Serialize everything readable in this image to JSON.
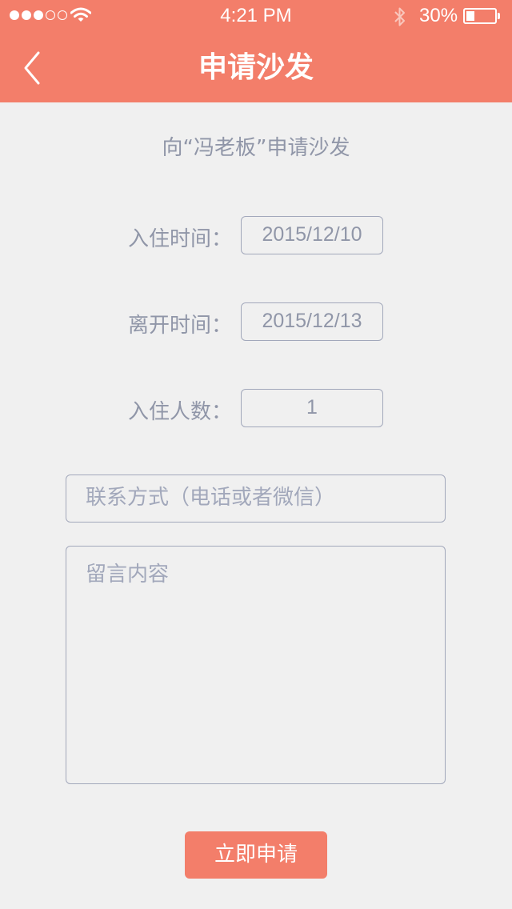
{
  "status_bar": {
    "time": "4:21 PM",
    "battery_percent": "30%",
    "battery_level": 0.3,
    "signal_bars_filled": 3,
    "signal_bars_total": 5
  },
  "nav": {
    "title": "申请沙发",
    "back_icon": "chevron-left-icon"
  },
  "form": {
    "subtitle": "向“冯老板”申请沙发",
    "checkin_label": "入住时间：",
    "checkin_value": "2015/12/10",
    "checkout_label": "离开时间：",
    "checkout_value": "2015/12/13",
    "guests_label": "入住人数：",
    "guests_value": "1",
    "contact_placeholder": "联系方式（电话或者微信）",
    "message_placeholder": "留言内容",
    "submit_label": "立即申请"
  },
  "colors": {
    "accent": "#f37e6a",
    "background": "#f0f0f0",
    "text_muted": "#9096a8"
  }
}
